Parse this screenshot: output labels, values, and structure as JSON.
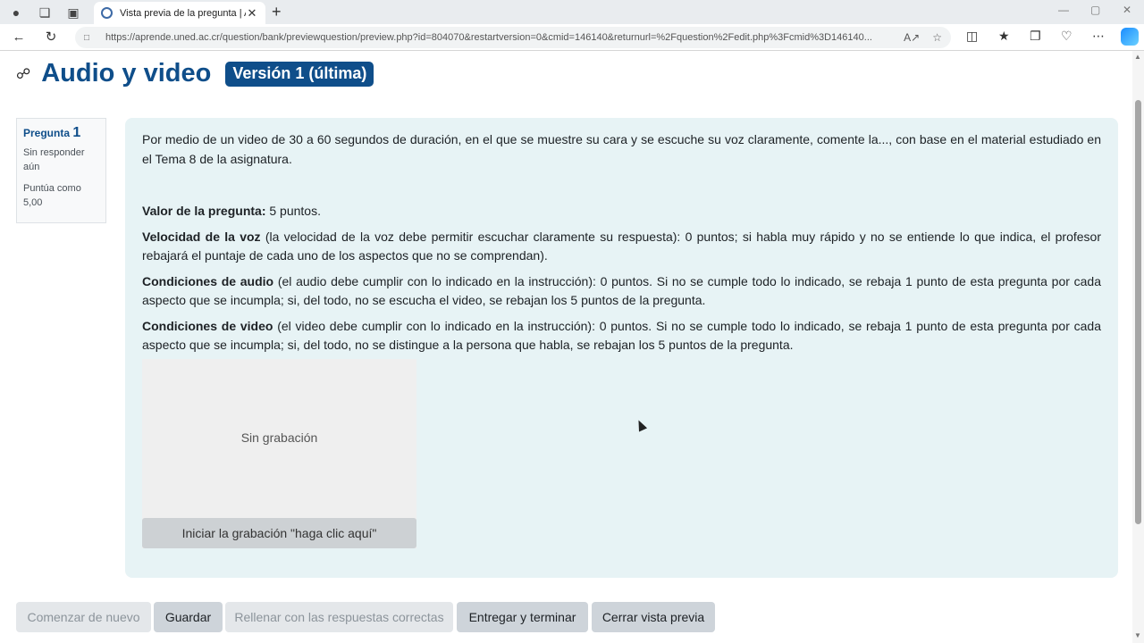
{
  "browser": {
    "tab_title": "Vista previa de la pregunta | Apr",
    "url": "https://aprende.uned.ac.cr/question/bank/previewquestion/preview.php?id=804070&restartversion=0&cmid=146140&returnurl=%2Fquestion%2Fedit.php%3Fcmid%3D146140..."
  },
  "page": {
    "title": "Audio y video",
    "version_badge": "Versión 1 (última)"
  },
  "question_info": {
    "label": "Pregunta",
    "number": "1",
    "status": "Sin responder aún",
    "grade": "Puntúa como 5,00"
  },
  "question": {
    "intro": "Por medio de un video de 30 a 60 segundos de duración, en el que se muestre su cara y se escuche su voz claramente, comente la..., con base en el material estudiado en el Tema 8 de la asignatura.",
    "items": [
      {
        "label": "Valor de la pregunta:",
        "text": " 5 puntos."
      },
      {
        "label": "Velocidad de la voz",
        "text": " (la velocidad de la voz debe permitir escuchar claramente su respuesta): 0 puntos; si habla muy rápido y no se entiende lo que indica, el profesor rebajará el puntaje de cada uno de los aspectos que no se comprendan)."
      },
      {
        "label": "Condiciones de audio",
        "text": " (el audio debe cumplir con lo indicado en la instrucción): 0 puntos. Si no se cumple todo lo indicado, se rebaja 1 punto de esta pregunta por cada aspecto que se incumpla; si, del todo, no se escucha el video, se rebajan los 5 puntos de la pregunta."
      },
      {
        "label": "Condiciones de video",
        "text": " (el video debe cumplir con lo indicado en la instrucción): 0 puntos. Si no se cumple todo lo indicado, se rebaja 1 punto de esta pregunta por cada aspecto que se incumpla; si, del todo, no se distingue a la persona que habla, se rebajan los 5 puntos de la pregunta."
      }
    ],
    "recorder_status": "Sin grabación",
    "record_button": "Iniciar la grabación \"haga clic aquí\""
  },
  "actions": {
    "restart": "Comenzar de nuevo",
    "save": "Guardar",
    "fill_correct": "Rellenar con las respuestas correctas",
    "submit": "Entregar y terminar",
    "close_preview": "Cerrar vista previa"
  },
  "colors": {
    "brand": "#0f4e8a",
    "question_bg": "#e7f3f5",
    "button_bg": "#ced4da"
  }
}
